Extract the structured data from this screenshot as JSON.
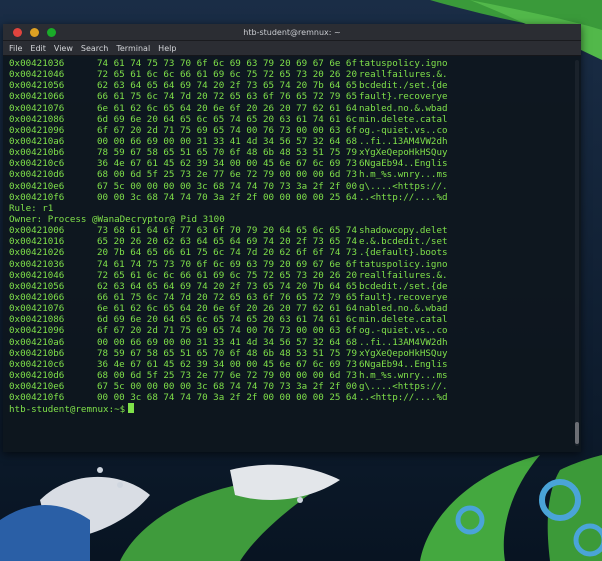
{
  "window": {
    "title": "htb-student@remnux: ~"
  },
  "menu": [
    "File",
    "Edit",
    "View",
    "Search",
    "Terminal",
    "Help"
  ],
  "block1": [
    {
      "addr": "0x00421036",
      "hex": "74 61 74 75 73 70 6f 6c 69 63 79 20 69 67 6e 6f",
      "ascii": "tatuspolicy.igno"
    },
    {
      "addr": "0x00421046",
      "hex": "72 65 61 6c 6c 66 61 69 6c 75 72 65 73 20 26 20",
      "ascii": "reallfailures.&."
    },
    {
      "addr": "0x00421056",
      "hex": "62 63 64 65 64 69 74 20 2f 73 65 74 20 7b 64 65",
      "ascii": "bcdedit./set.{de"
    },
    {
      "addr": "0x00421066",
      "hex": "66 61 75 6c 74 7d 20 72 65 63 6f 76 65 72 79 65",
      "ascii": "fault}.recoverye"
    },
    {
      "addr": "0x00421076",
      "hex": "6e 61 62 6c 65 64 20 6e 6f 20 26 20 77 62 61 64",
      "ascii": "nabled.no.&.wbad"
    },
    {
      "addr": "0x00421086",
      "hex": "6d 69 6e 20 64 65 6c 65 74 65 20 63 61 74 61 6c",
      "ascii": "min.delete.catal"
    },
    {
      "addr": "0x00421096",
      "hex": "6f 67 20 2d 71 75 69 65 74 00 76 73 00 00 63 6f",
      "ascii": "og.-quiet.vs..co"
    },
    {
      "addr": "0x004210a6",
      "hex": "00 00 66 69 00 00 31 33 41 4d 34 56 57 32 64 68",
      "ascii": "..fi..13AM4VW2dh"
    },
    {
      "addr": "0x004210b6",
      "hex": "78 59 67 58 65 51 65 70 6f 48 6b 48 53 51 75 79",
      "ascii": "xYgXeQepoHkHSQuy"
    },
    {
      "addr": "0x004210c6",
      "hex": "36 4e 67 61 45 62 39 34 00 00 45 6e 67 6c 69 73",
      "ascii": "6NgaEb94..Englis"
    },
    {
      "addr": "0x004210d6",
      "hex": "68 00 6d 5f 25 73 2e 77 6e 72 79 00 00 00 6d 73",
      "ascii": "h.m_%s.wnry...ms"
    },
    {
      "addr": "0x004210e6",
      "hex": "67 5c 00 00 00 00 3c 68 74 74 70 73 3a 2f 2f 00",
      "ascii": "g\\....<https://."
    },
    {
      "addr": "0x004210f6",
      "hex": "00 00 3c 68 74 74 70 3a 2f 2f 00 00 00 00 25 64",
      "ascii": "..<http://....%d"
    }
  ],
  "rule": "Rule: r1",
  "owner": "Owner: Process @WanaDecryptor@ Pid 3100",
  "block2": [
    {
      "addr": "0x00421006",
      "hex": "73 68 61 64 6f 77 63 6f 70 79 20 64 65 6c 65 74",
      "ascii": "shadowcopy.delet"
    },
    {
      "addr": "0x00421016",
      "hex": "65 20 26 20 62 63 64 65 64 69 74 20 2f 73 65 74",
      "ascii": "e.&.bcdedit./set"
    },
    {
      "addr": "0x00421026",
      "hex": "20 7b 64 65 66 61 75 6c 74 7d 20 62 6f 6f 74 73",
      "ascii": ".{default}.boots"
    },
    {
      "addr": "0x00421036",
      "hex": "74 61 74 75 73 70 6f 6c 69 63 79 20 69 67 6e 6f",
      "ascii": "tatuspolicy.igno"
    },
    {
      "addr": "0x00421046",
      "hex": "72 65 61 6c 6c 66 61 69 6c 75 72 65 73 20 26 20",
      "ascii": "reallfailures.&."
    },
    {
      "addr": "0x00421056",
      "hex": "62 63 64 65 64 69 74 20 2f 73 65 74 20 7b 64 65",
      "ascii": "bcdedit./set.{de"
    },
    {
      "addr": "0x00421066",
      "hex": "66 61 75 6c 74 7d 20 72 65 63 6f 76 65 72 79 65",
      "ascii": "fault}.recoverye"
    },
    {
      "addr": "0x00421076",
      "hex": "6e 61 62 6c 65 64 20 6e 6f 20 26 20 77 62 61 64",
      "ascii": "nabled.no.&.wbad"
    },
    {
      "addr": "0x00421086",
      "hex": "6d 69 6e 20 64 65 6c 65 74 65 20 63 61 74 61 6c",
      "ascii": "min.delete.catal"
    },
    {
      "addr": "0x00421096",
      "hex": "6f 67 20 2d 71 75 69 65 74 00 76 73 00 00 63 6f",
      "ascii": "og.-quiet.vs..co"
    },
    {
      "addr": "0x004210a6",
      "hex": "00 00 66 69 00 00 31 33 41 4d 34 56 57 32 64 68",
      "ascii": "..fi..13AM4VW2dh"
    },
    {
      "addr": "0x004210b6",
      "hex": "78 59 67 58 65 51 65 70 6f 48 6b 48 53 51 75 79",
      "ascii": "xYgXeQepoHkHSQuy"
    },
    {
      "addr": "0x004210c6",
      "hex": "36 4e 67 61 45 62 39 34 00 00 45 6e 67 6c 69 73",
      "ascii": "6NgaEb94..Englis"
    },
    {
      "addr": "0x004210d6",
      "hex": "68 00 6d 5f 25 73 2e 77 6e 72 79 00 00 00 6d 73",
      "ascii": "h.m_%s.wnry...ms"
    },
    {
      "addr": "0x004210e6",
      "hex": "67 5c 00 00 00 00 3c 68 74 74 70 73 3a 2f 2f 00",
      "ascii": "g\\....<https://."
    },
    {
      "addr": "0x004210f6",
      "hex": "00 00 3c 68 74 74 70 3a 2f 2f 00 00 00 00 25 64",
      "ascii": "..<http://....%d"
    }
  ],
  "prompt": "htb-student@remnux:~$",
  "colors": {
    "text": "#7fe04a",
    "background": "#0e161e",
    "titlebar": "#2b2d33"
  }
}
